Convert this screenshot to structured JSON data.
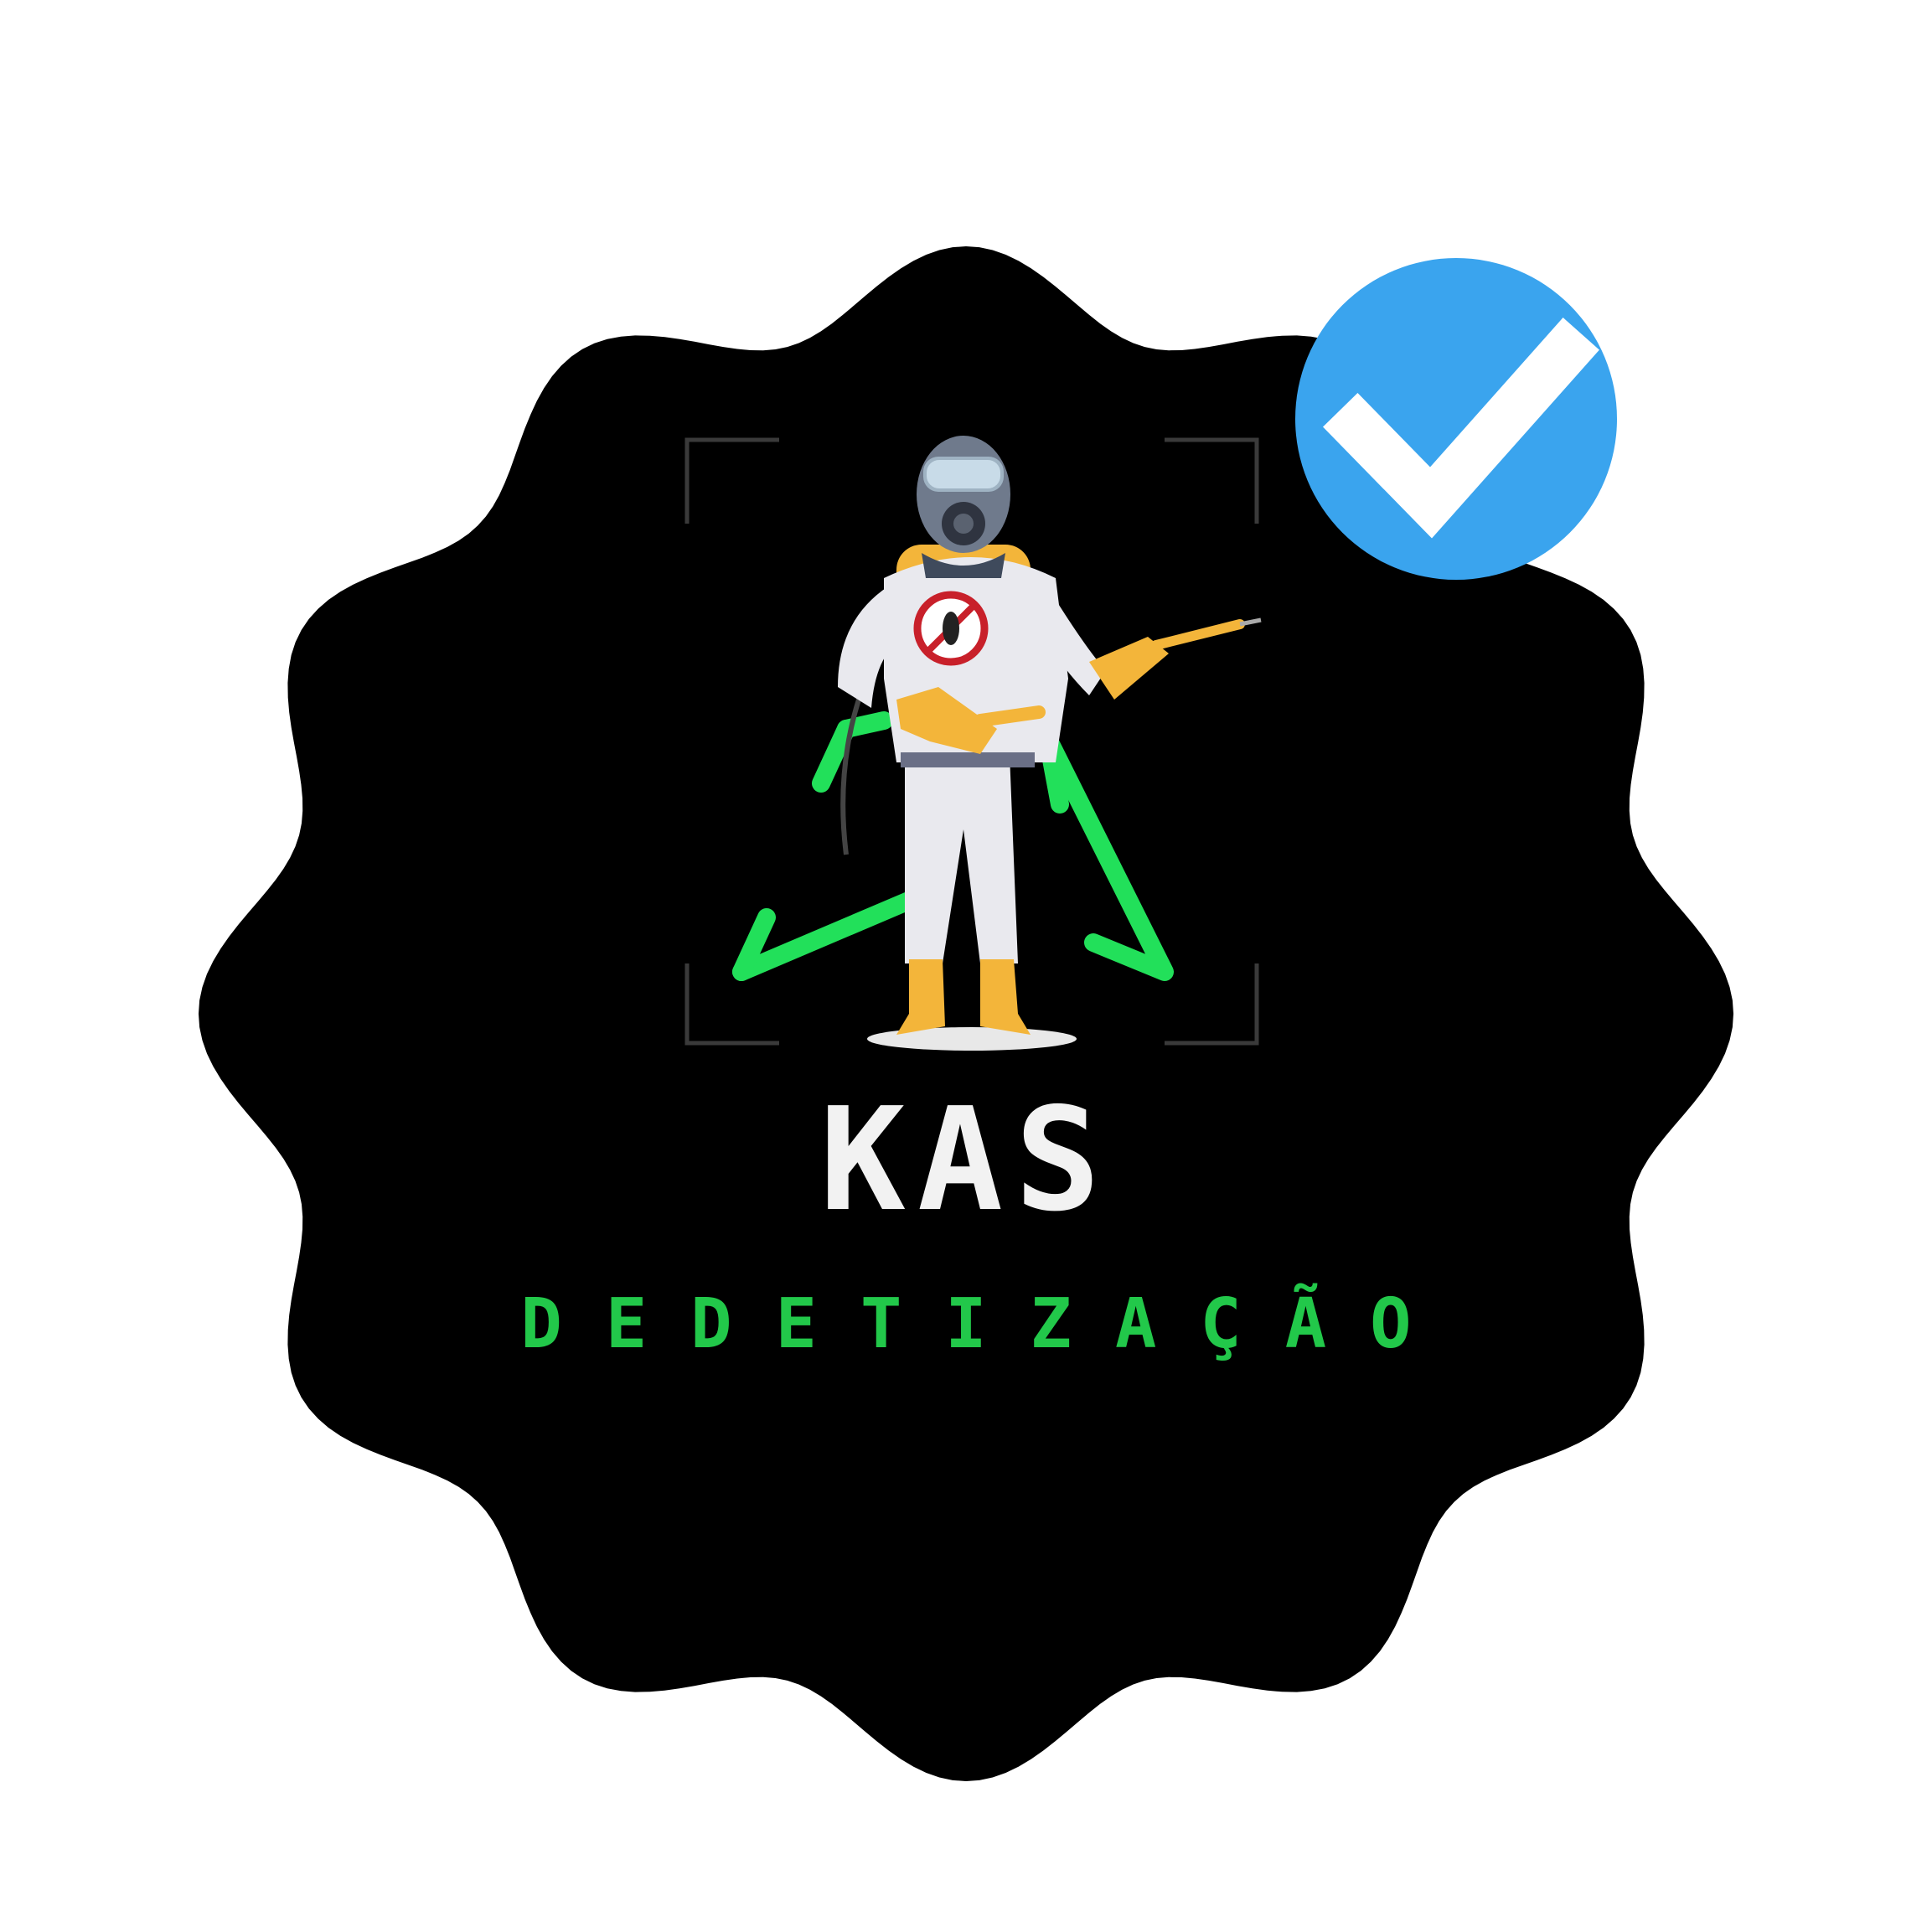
{
  "logo": {
    "brand_name": "KAS",
    "tagline": "DEDETIZAÇÃO",
    "icons": [
      "wavy-badge-background",
      "exterminator-figure-icon",
      "recycle-triangle-icon",
      "camera-frame-icon",
      "verified-check-icon"
    ]
  },
  "colors": {
    "page_background": "#ffffff",
    "badge_background": "#000000",
    "tagline_green": "#22c84a",
    "brand_text": "#f2f2f2",
    "verified_blue": "#3aa4ee",
    "suit_white": "#e9e9ee",
    "glove_yellow": "#f3b53a",
    "frame_gray": "#3a3a3a"
  }
}
